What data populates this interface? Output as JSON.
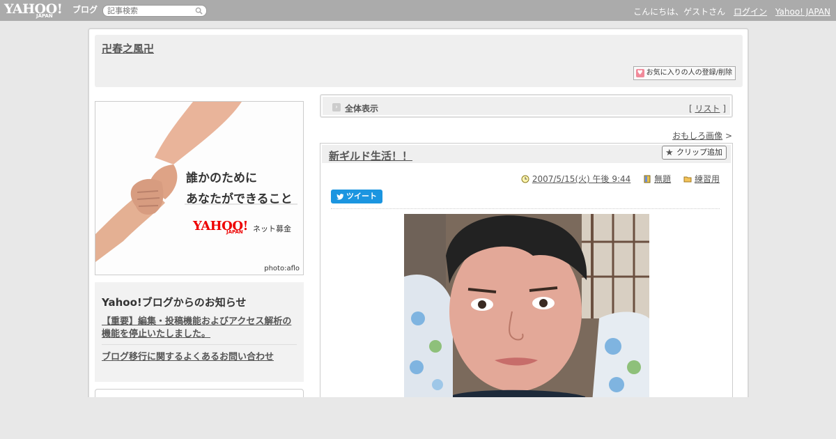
{
  "topbar": {
    "logo_text": "YAHOO!",
    "logo_sub": "JAPAN",
    "logo_blog": "ブログ",
    "search_placeholder": "記事検索",
    "greeting": "こんにちは、ゲストさん",
    "login": "ログイン",
    "yahoo_japan": "Yahoo! JAPAN"
  },
  "header": {
    "blog_title": "卍春之風卍",
    "favorite_button": "お気に入りの人の登録/削除"
  },
  "banner": {
    "line1": "誰かのために",
    "line2": "あなたができること",
    "logo": "YAHOO!",
    "logo_sub": "JAPAN",
    "service": "ネット募金",
    "credit": "photo:aflo"
  },
  "notice": {
    "heading": "Yahoo!ブログからのお知らせ",
    "link1": "【重要】編集・投稿機能およびアクセス解析の機能を停止いたしました。",
    "link2": "ブログ移行に関するよくあるお問い合わせ"
  },
  "view_all": {
    "label": "全体表示",
    "list_open": "[",
    "list_link": "リスト",
    "list_close": "]"
  },
  "prev_link": {
    "label": "おもしろ画像",
    "arrow": ">"
  },
  "article": {
    "title": "新ギルド生活！！",
    "clip_button": "クリップ追加",
    "datetime": "2007/5/15(火) 午後 9:44",
    "label": "無題",
    "category": "練習用",
    "tweet": "ツイート"
  },
  "colors": {
    "topbar": "#ababab",
    "tweet": "#1b95e0",
    "header_bg": "#efefef",
    "banner_logo": "#e00000"
  }
}
